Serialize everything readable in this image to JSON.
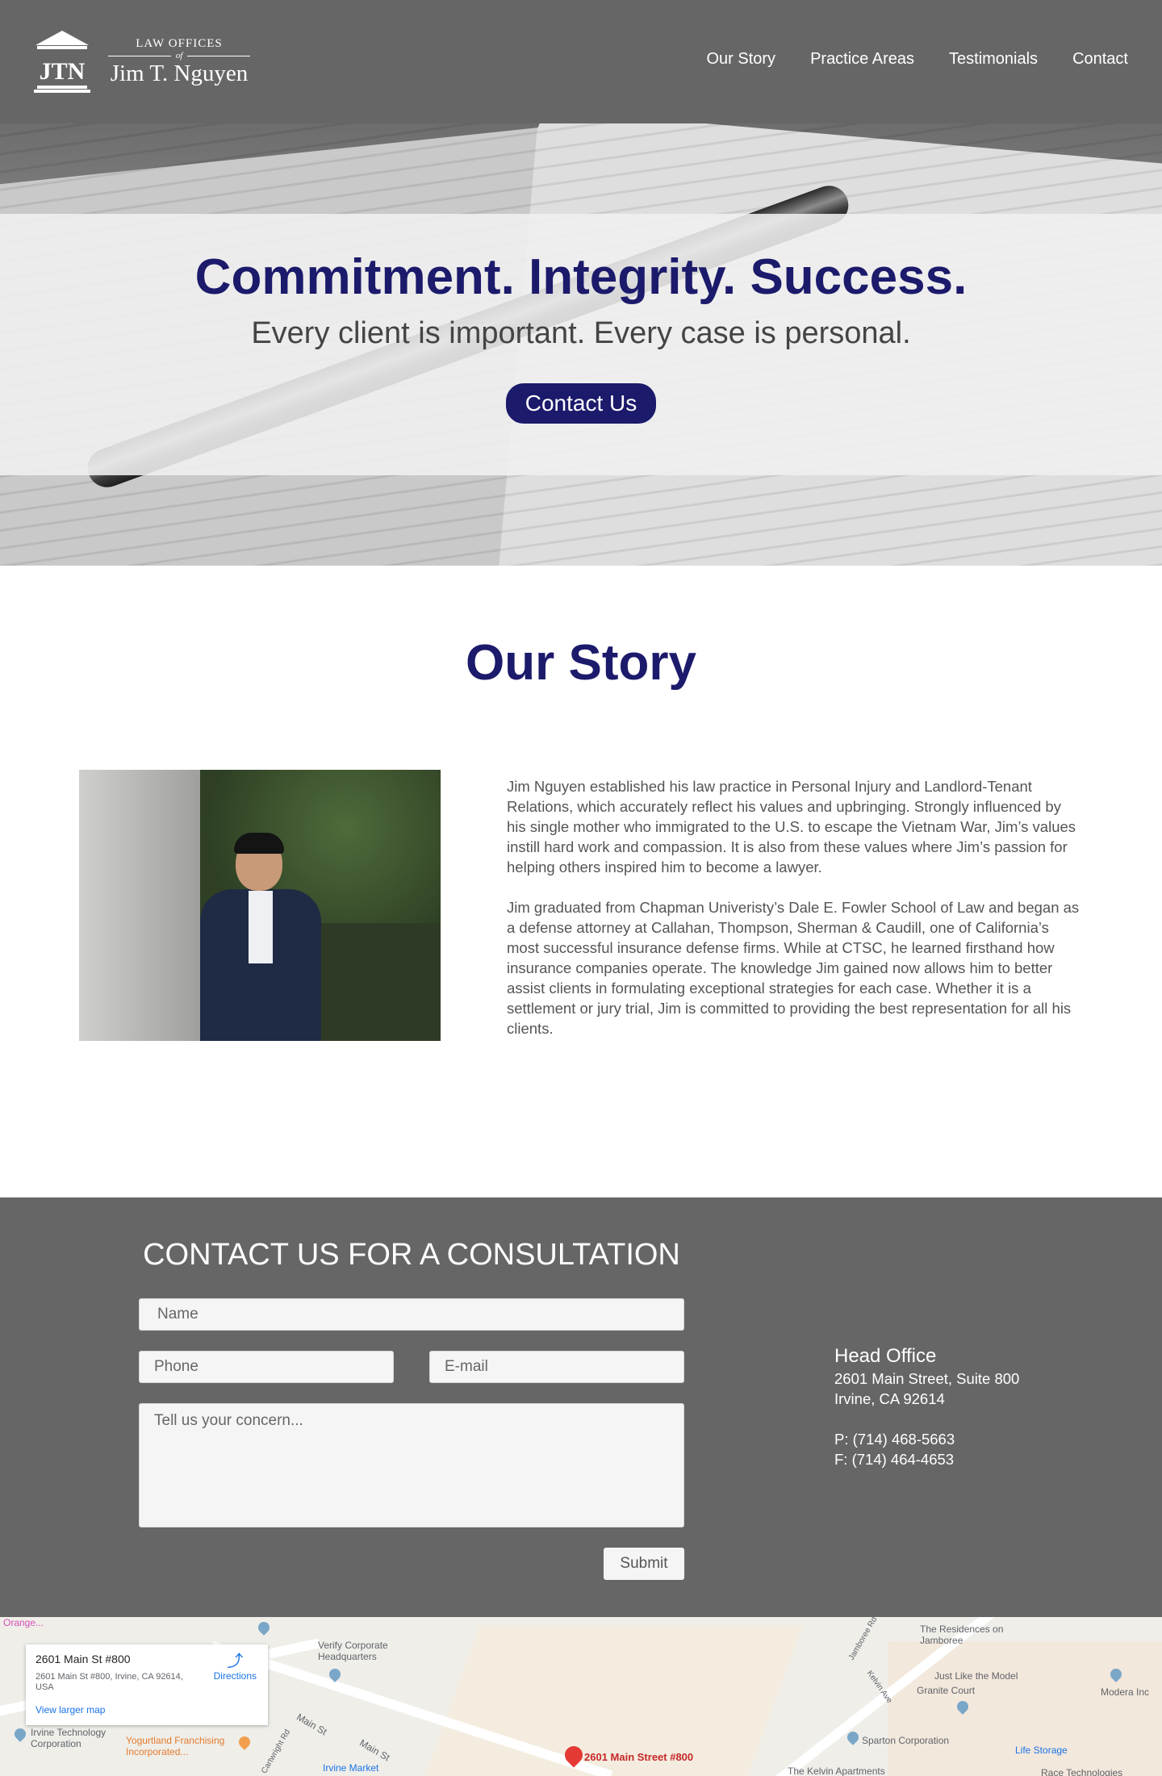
{
  "header": {
    "logo_mark": "JTN",
    "logo_small": "LAW OFFICES",
    "logo_of": "of",
    "logo_name": "Jim T. Nguyen",
    "nav": [
      "Our Story",
      "Practice Areas",
      "Testimonials",
      "Contact"
    ]
  },
  "hero": {
    "title": "Commitment. Integrity. Success.",
    "subtitle": "Every client is important. Every case is personal.",
    "button": "Contact Us"
  },
  "story": {
    "title": "Our Story",
    "paragraphs": [
      "Jim Nguyen established his law practice in Personal Injury and Landlord-Tenant Relations, which accurately reflect his values and upbringing. Strongly influenced by his single mother who immigrated to the U.S. to escape the Vietnam War, Jim’s values instill hard work and compassion. It is also from these values where Jim’s passion for helping others inspired him to become a lawyer.",
      "Jim graduated from Chapman Univeristy’s Dale E. Fowler School of Law and began as a defense attorney at Callahan, Thompson, Sherman & Caudill, one of California’s most successful insurance defense firms. While at CTSC, he learned firsthand how insurance companies operate. The knowledge Jim gained now allows him to better assist clients in formulating exceptional strategies for each case. Whether it is a settlement or jury trial, Jim is committed to providing the best representation for all his clients."
    ]
  },
  "contact": {
    "title": "CONTACT US FOR A CONSULTATION",
    "name_placeholder": "Name",
    "phone_placeholder": "Phone",
    "email_placeholder": "E-mail",
    "message_placeholder": "Tell us your concern...",
    "submit": "Submit",
    "office": {
      "title": "Head Office",
      "line1": "2601 Main Street, Suite 800",
      "line2": "Irvine, CA 92614",
      "phone": "P: (714) 468-5663",
      "fax": "F: (714) 464-4653"
    }
  },
  "map": {
    "card_title": "2601 Main St #800",
    "card_address": "2601 Main St #800, Irvine, CA 92614, USA",
    "directions": "Directions",
    "larger_map": "View larger map",
    "pin_label": "2601 Main Street #800",
    "labels": [
      "Orange...",
      "Verify Corporate Headquarters",
      "The Residences on Jamboree",
      "Just Like the Model",
      "Granite Court",
      "Modera Inc",
      "Irvine Technology Corporation",
      "Yogurtland Franchising Incorporated...",
      "Main St",
      "Main St",
      "Cartwright Rd",
      "Irvine Market",
      "Sparton Corporation",
      "Life Storage",
      "The Kelvin Apartments",
      "Race Technologies",
      "Kelvin Ave",
      "Jamboree Rd"
    ]
  },
  "colors": {
    "header_bg": "#666666",
    "brand_navy": "#1c1a6b",
    "contact_bg": "#666666"
  }
}
